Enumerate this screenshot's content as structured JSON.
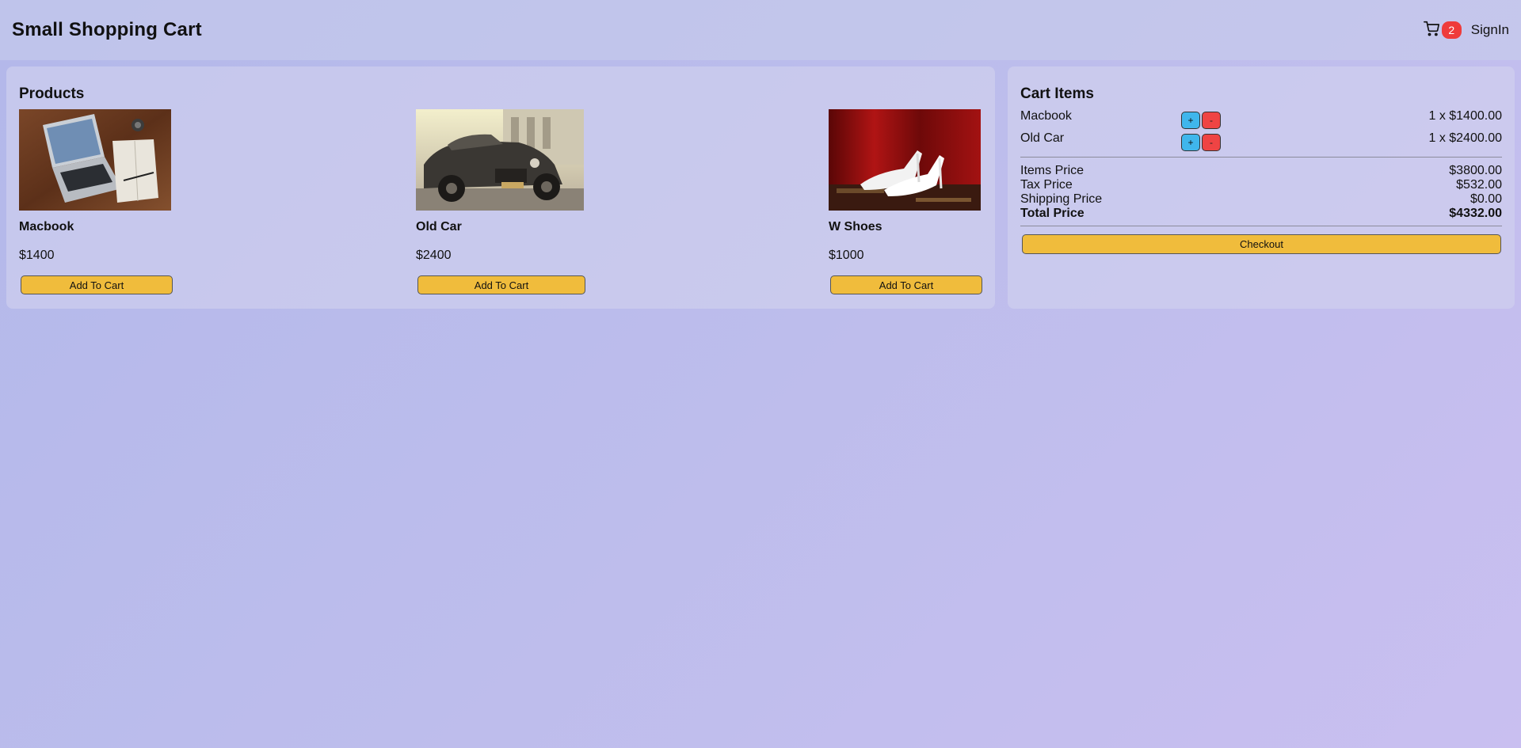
{
  "header": {
    "title": "Small Shopping Cart",
    "cart_icon": "cart-icon",
    "cart_count": "2",
    "signin_label": "SignIn"
  },
  "products": {
    "title": "Products",
    "items": [
      {
        "name": "Macbook",
        "price": "$1400",
        "button": "Add To Cart",
        "image": "laptop-photo"
      },
      {
        "name": "Old Car",
        "price": "$2400",
        "button": "Add To Cart",
        "image": "vintage-car-photo"
      },
      {
        "name": "W Shoes",
        "price": "$1000",
        "button": "Add To Cart",
        "image": "white-heels-photo"
      }
    ]
  },
  "cart": {
    "title": "Cart Items",
    "lines": [
      {
        "name": "Macbook",
        "plus": "+",
        "minus": "-",
        "amount": "1 x $1400.00"
      },
      {
        "name": "Old Car",
        "plus": "+",
        "minus": "-",
        "amount": "1 x $2400.00"
      }
    ],
    "summary": {
      "items_label": "Items Price",
      "items_value": "$3800.00",
      "tax_label": "Tax Price",
      "tax_value": "$532.00",
      "shipping_label": "Shipping Price",
      "shipping_value": "$0.00",
      "total_label": "Total Price",
      "total_value": "$4332.00"
    },
    "checkout_label": "Checkout"
  },
  "colors": {
    "accent_button": "#f0bc3c",
    "plus_button": "#3fb6ec",
    "minus_button": "#ef4444",
    "badge": "#ef3b3b"
  }
}
